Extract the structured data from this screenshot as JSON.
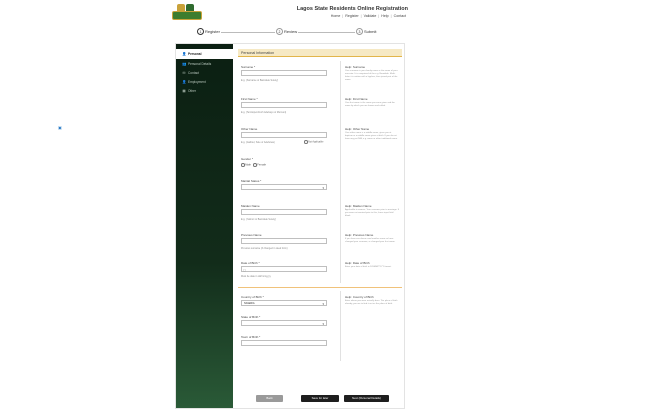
{
  "header": {
    "title": "Lagos State Residents Online Registration",
    "nav": [
      "Home",
      "Register",
      "Validate",
      "Help",
      "Contact"
    ],
    "nav_separator": "|"
  },
  "stepper": [
    {
      "num": "1",
      "label": "Register",
      "active": true
    },
    {
      "num": "2",
      "label": "Review",
      "active": false
    },
    {
      "num": "3",
      "label": "Submit",
      "active": false
    }
  ],
  "sidebar": {
    "items": [
      {
        "label": "Personal",
        "icon": "user-icon",
        "glyph": "👤"
      },
      {
        "label": "Personal Details",
        "icon": "users-icon",
        "glyph": "👥"
      },
      {
        "label": "Contact",
        "icon": "mail-icon",
        "glyph": "✉"
      },
      {
        "label": "Employment",
        "icon": "briefcase-icon",
        "glyph": "👤"
      },
      {
        "label": "Other",
        "icon": "folder-icon",
        "glyph": "▦"
      }
    ]
  },
  "form": {
    "section_title": "Personal Information",
    "surname": {
      "label": "Surname *",
      "value": "",
      "hint": "E.g. (Surname or Bamidele Surely)",
      "help_title": "Help: Surname",
      "help_text": "Your surname is your family name or the name of your ancestor. It is comprised of the e.g. Bamidele. Multi-letter it is written with a hyphen, then joined part of the name."
    },
    "first_name": {
      "label": "First Name *",
      "value": "",
      "hint": "E.g. (Temitope/Jimoh Adebayo or Mumuni)",
      "help_title": "Help: First Name",
      "help_text": "Your first name is the name you were given and the name by which you are known and called."
    },
    "other_name": {
      "label": "Other Name",
      "value": "",
      "hint": "E.g. (Gabriel, Sule or Adebowa)",
      "checkbox_label": "Not Applicable",
      "help_title": "Help: Other Name",
      "help_text": "Your other name is a middle name, given you at baptism or a middle name given at birth. If you do not have any put N/A, e.g. name or other traditional name."
    },
    "gender": {
      "label": "Gender *",
      "options": [
        "Male",
        "Female"
      ]
    },
    "marital_status": {
      "label": "Marital Status *",
      "value": ""
    },
    "maiden_name": {
      "label": "Maiden Name",
      "value": "",
      "hint": "E.g. (Yekinni or Bamidele Surely)",
      "help_title": "Help: Maiden Name",
      "help_text": "Applicable to women. Your surname prior to marriage. If you were not married prior to this, leave input field blank."
    },
    "previous_name": {
      "label": "Previous Name",
      "value": "",
      "hint": "Previous surname (if changed in deed form)",
      "help_title": "Help: Previous Name",
      "help_text": "If you have ever been used another name or have changed your surname, or changed your first name."
    },
    "date_of_birth": {
      "label": "Date of Birth *",
      "value": "",
      "hint": "Must be date in dd/mm/yyyy",
      "help_title": "Help: Date of Birth",
      "help_text": "Enter your date of birth in DD/MM/YYYY format."
    },
    "country_of_birth": {
      "label": "Country of Birth *",
      "value": "NIGERIA",
      "help_title": "Help: Country of Birth",
      "help_text": "Enter where you were actually born. The place of birth already, you are to find it out as the place of birth."
    },
    "state_of_birth": {
      "label": "State of Birth *",
      "value": ""
    },
    "town_of_birth": {
      "label": "Town of Birth *",
      "value": ""
    }
  },
  "buttons": {
    "back": "Back",
    "save": "Save for later",
    "next": "Next (Personal Details)"
  },
  "colors": {
    "sidebar_dark": "#0b1f12",
    "section_bg": "#f6e9c4",
    "accent": "#e2b54a",
    "button_dark": "#1e1e1e"
  }
}
